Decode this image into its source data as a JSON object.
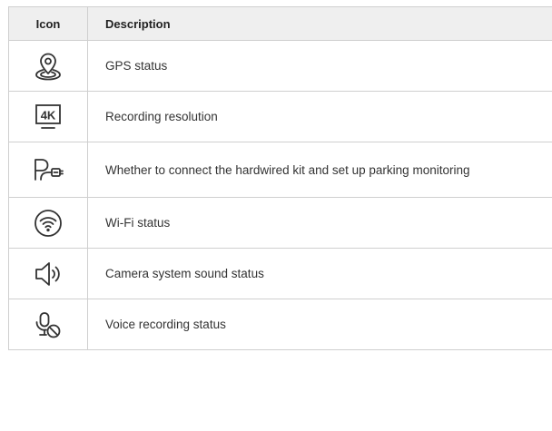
{
  "header": {
    "icon": "Icon",
    "description": "Description"
  },
  "rows": [
    {
      "icon": "gps-location-icon",
      "description": "GPS status"
    },
    {
      "icon": "resolution-4k-icon",
      "description": "Recording resolution"
    },
    {
      "icon": "parking-hardwire-icon",
      "description": "Whether to connect the hardwired kit and set up parking monitoring"
    },
    {
      "icon": "wifi-icon",
      "description": "Wi-Fi status"
    },
    {
      "icon": "speaker-icon",
      "description": "Camera system sound status"
    },
    {
      "icon": "mic-muted-icon",
      "description": "Voice recording status"
    }
  ],
  "icon_text": {
    "resolution": "4K"
  }
}
